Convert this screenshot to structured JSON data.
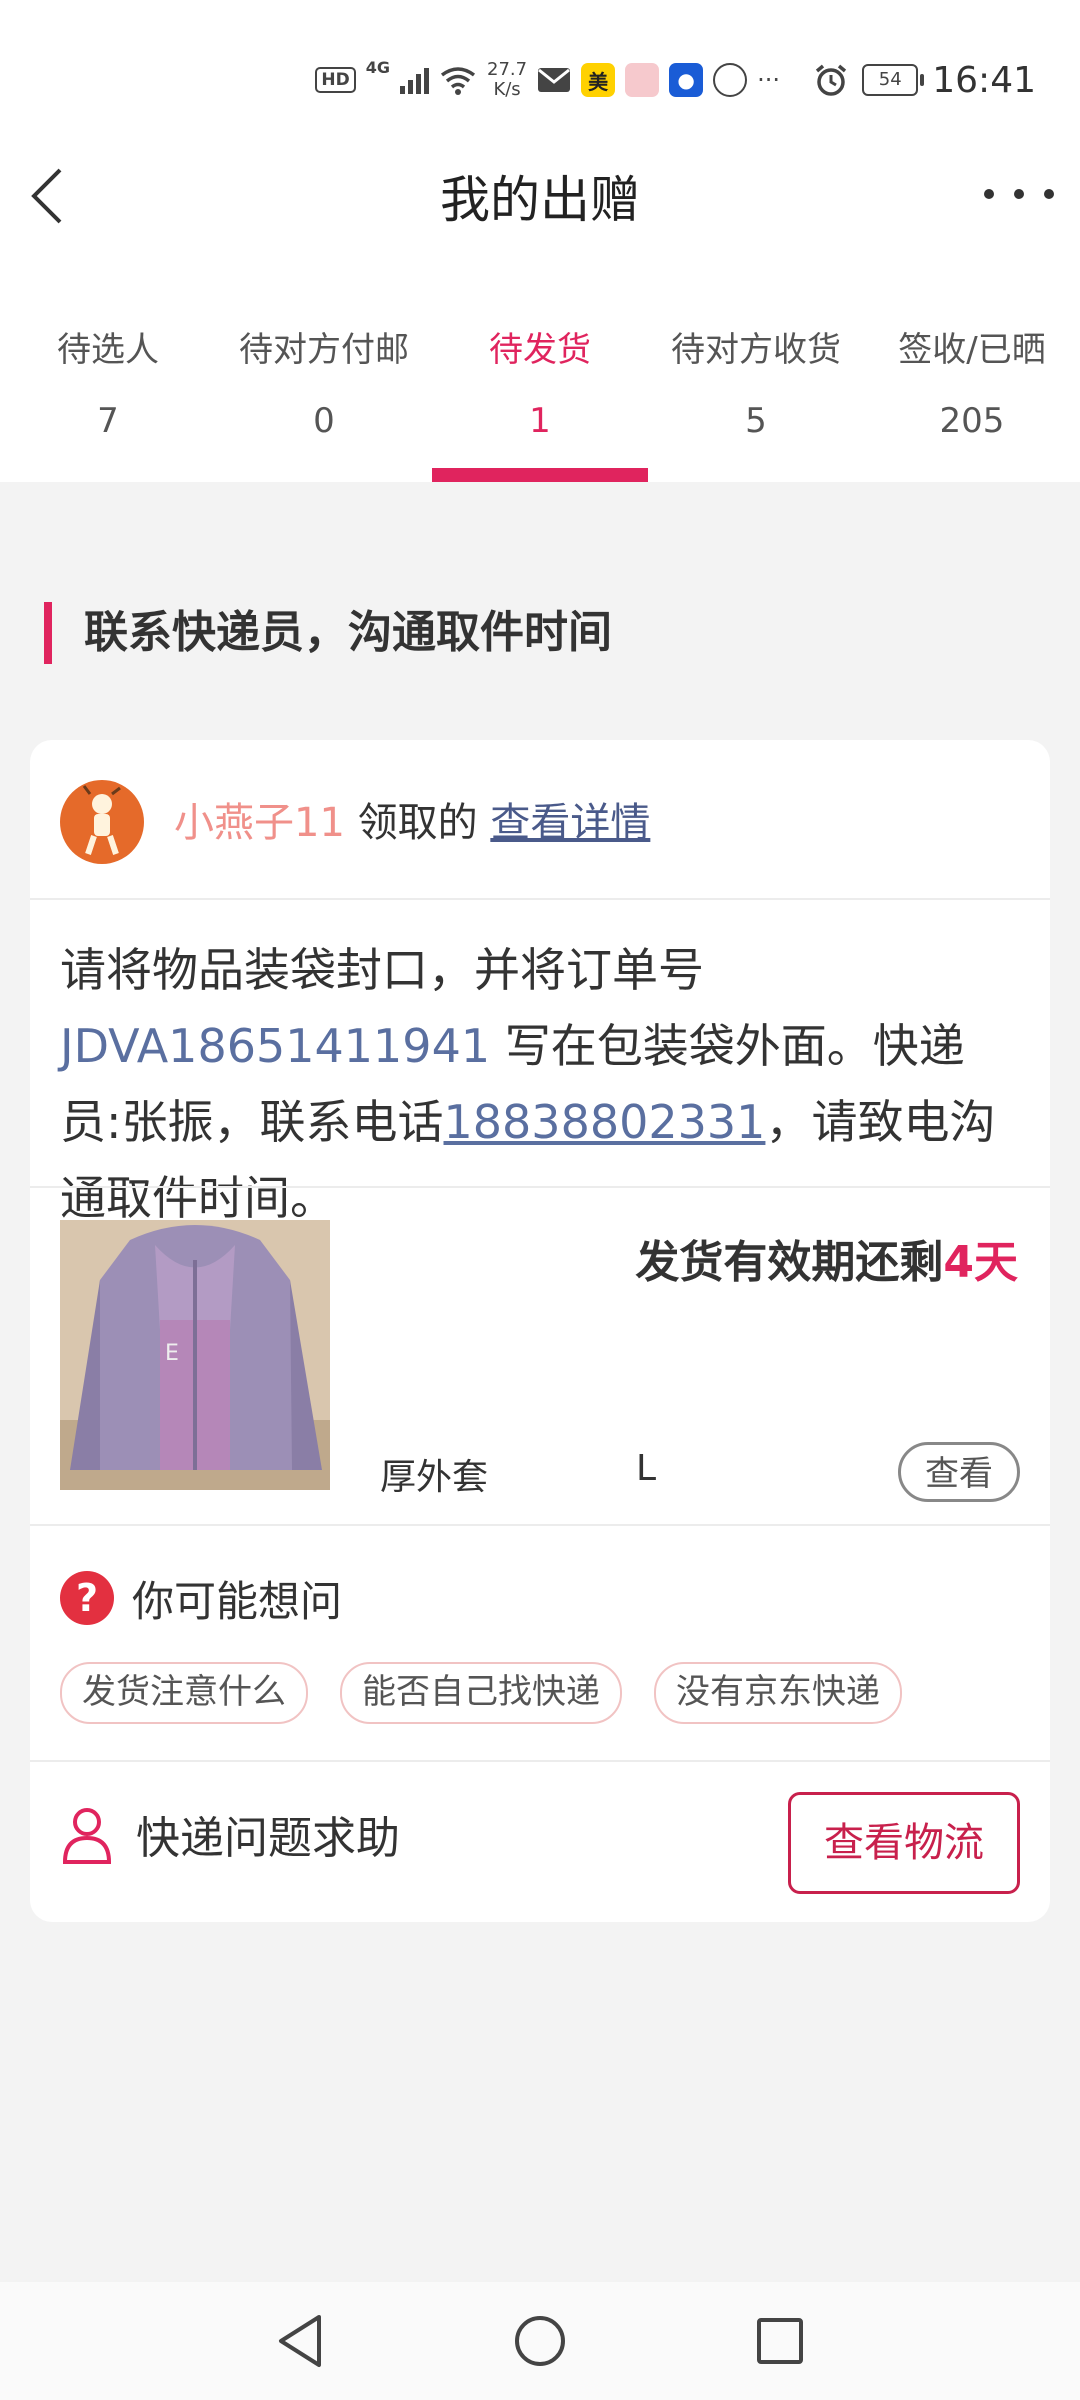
{
  "status_bar": {
    "hd": "HD",
    "network": "4G",
    "speed_value": "27.7",
    "speed_unit": "K/s",
    "meituan_label": "美",
    "battery": "54",
    "time": "16:41"
  },
  "header": {
    "title": "我的出赠"
  },
  "tabs": [
    {
      "label": "待选人",
      "count": "7"
    },
    {
      "label": "待对方付邮",
      "count": "0"
    },
    {
      "label": "待发货",
      "count": "1"
    },
    {
      "label": "待对方收货",
      "count": "5"
    },
    {
      "label": "签收/已晒",
      "count": "205"
    }
  ],
  "active_tab_index": 2,
  "section": {
    "heading": "联系快递员，沟通取件时间"
  },
  "card": {
    "user_name": "小燕子11",
    "claimed_text": " 领取的 ",
    "details_link": "查看详情",
    "instruction_pre": "请将物品装袋封口，并将订单号 ",
    "order_number": "JDVA18651411941",
    "instruction_mid": " 写在包装袋外面。快递员:张振，联系电话",
    "phone": "18838802331",
    "instruction_post": "，请致电沟通取件时间。",
    "deadline_label": "发货有效期还剩",
    "deadline_days": "4天",
    "product_name": "厚外套",
    "product_size": "L",
    "view_button": "查看",
    "faq_title": "你可能想问",
    "faq_tags": [
      "发货注意什么",
      "能否自己找快递",
      "没有京东快递"
    ],
    "help_label": "快递问题求助",
    "logistics_button": "查看物流"
  },
  "colors": {
    "accent": "#e0245e",
    "link": "#5a6fa0",
    "username": "#f0908a",
    "background": "#f3f3f3"
  },
  "icons": {
    "back": "chevron-left-icon",
    "more": "more-dots-icon",
    "faq": "question-icon",
    "help": "person-icon"
  }
}
